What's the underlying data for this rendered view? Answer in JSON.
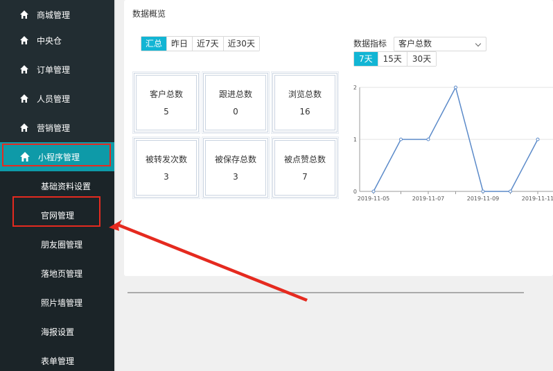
{
  "sidebar": {
    "items": [
      {
        "label": "商城管理",
        "icon": "home-icon"
      },
      {
        "label": "中央仓",
        "icon": "home-icon"
      },
      {
        "label": "订单管理",
        "icon": "home-icon"
      },
      {
        "label": "人员管理",
        "icon": "home-icon"
      },
      {
        "label": "营销管理",
        "icon": "home-icon"
      },
      {
        "label": "小程序管理",
        "icon": "home-icon",
        "active": true
      }
    ],
    "sub_items": [
      {
        "label": "基础资料设置"
      },
      {
        "label": "官网管理"
      },
      {
        "label": "朋友圈管理"
      },
      {
        "label": "落地页管理"
      },
      {
        "label": "照片墙管理"
      },
      {
        "label": "海报设置"
      },
      {
        "label": "表单管理"
      }
    ]
  },
  "panel": {
    "title": "数据概览",
    "tabs": [
      "汇总",
      "昨日",
      "近7天",
      "近30天"
    ],
    "active_tab": "汇总",
    "stats": [
      {
        "label": "客户总数",
        "value": "5"
      },
      {
        "label": "跟进总数",
        "value": "0"
      },
      {
        "label": "浏览总数",
        "value": "16"
      },
      {
        "label": "被转发次数",
        "value": "3"
      },
      {
        "label": "被保存总数",
        "value": "3"
      },
      {
        "label": "被点赞总数",
        "value": "7"
      }
    ],
    "metric_label": "数据指标",
    "metric_selected": "客户总数",
    "range_tabs": [
      "7天",
      "15天",
      "30天"
    ],
    "active_range": "7天"
  },
  "colors": {
    "sidebar_bg": "#222d32",
    "active_bg": "#0e9aa8",
    "tab_active": "#12b5d4",
    "line": "#5b8ac9",
    "highlight": "#e52a1f"
  },
  "chart_data": {
    "type": "line",
    "x": [
      "2019-11-05",
      "2019-11-06",
      "2019-11-07",
      "2019-11-08",
      "2019-11-09",
      "2019-11-10",
      "2019-11-11"
    ],
    "tick_labels": [
      "2019-11-05",
      "2019-11-07",
      "2019-11-09",
      "2019-11-11"
    ],
    "values": [
      0,
      1,
      1,
      2,
      0,
      0,
      1
    ],
    "y_ticks": [
      "0",
      "1",
      "2"
    ],
    "ylim": [
      0,
      2
    ],
    "grid": true
  }
}
